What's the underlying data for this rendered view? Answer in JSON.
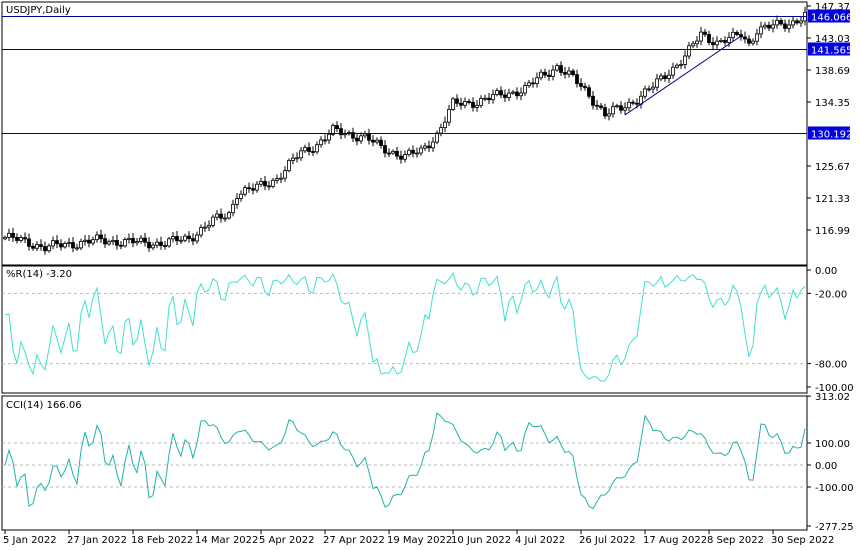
{
  "chart_data": [
    {
      "type": "candlestick",
      "title": "USDJPY,Daily",
      "symbol": "USDJPY",
      "timeframe": "Daily",
      "yticks": [
        147.37,
        143.03,
        138.69,
        134.35,
        125.67,
        121.33,
        116.99
      ],
      "ylim": [
        113.5,
        147.9
      ],
      "hlines": [
        {
          "label": "146.066",
          "value": 146.066
        },
        {
          "label": "141.565",
          "value": 141.565
        },
        {
          "label": "130.192",
          "value": 130.192
        }
      ],
      "trendline": {
        "from": [
          155,
          132.6
        ],
        "to": [
          184,
          143.3
        ]
      },
      "close_waypoints": [
        [
          0,
          116.0
        ],
        [
          6,
          115.3
        ],
        [
          10,
          114.6
        ],
        [
          16,
          115.1
        ],
        [
          24,
          115.6
        ],
        [
          32,
          115.3
        ],
        [
          40,
          115.2
        ],
        [
          46,
          115.9
        ],
        [
          52,
          118.2
        ],
        [
          56,
          119.2
        ],
        [
          58,
          122.0
        ],
        [
          62,
          122.5
        ],
        [
          68,
          124.0
        ],
        [
          74,
          127.5
        ],
        [
          78,
          128.6
        ],
        [
          82,
          130.4
        ],
        [
          86,
          130.0
        ],
        [
          90,
          129.6
        ],
        [
          94,
          128.1
        ],
        [
          100,
          127.0
        ],
        [
          104,
          127.6
        ],
        [
          108,
          130.0
        ],
        [
          112,
          134.0
        ],
        [
          118,
          134.4
        ],
        [
          124,
          135.3
        ],
        [
          130,
          136.1
        ],
        [
          134,
          137.8
        ],
        [
          138,
          139.2
        ],
        [
          142,
          137.5
        ],
        [
          146,
          135.4
        ],
        [
          150,
          132.6
        ],
        [
          154,
          133.5
        ],
        [
          158,
          134.8
        ],
        [
          162,
          136.4
        ],
        [
          166,
          138.5
        ],
        [
          170,
          140.5
        ],
        [
          174,
          143.5
        ],
        [
          178,
          142.5
        ],
        [
          182,
          143.0
        ],
        [
          184,
          143.5
        ],
        [
          186,
          142.2
        ],
        [
          188,
          144.2
        ],
        [
          192,
          144.6
        ],
        [
          196,
          145.0
        ],
        [
          200,
          146.1
        ]
      ]
    },
    {
      "type": "line",
      "title": "%R(14) -3.20",
      "yticks": [
        "0.00",
        "-20.00",
        "-80.00",
        "-100.00"
      ],
      "ylim": [
        -100,
        0
      ],
      "levels": [
        -20,
        -80
      ]
    },
    {
      "type": "line",
      "title": "CCI(14) 166.06",
      "yticks": [
        "313.02",
        "100.00",
        "0.00",
        "-100.00",
        "-277.25"
      ],
      "ylim": [
        -277.25,
        313.02
      ],
      "levels": [
        100,
        0,
        -100
      ]
    }
  ],
  "xticks": [
    "5 Jan 2022",
    "27 Jan 2022",
    "18 Feb 2022",
    "14 Mar 2022",
    "5 Apr 2022",
    "27 Apr 2022",
    "19 May 2022",
    "10 Jun 2022",
    "4 Jul 2022",
    "26 Jul 2022",
    "17 Aug 2022",
    "8 Sep 2022",
    "30 Sep 2022"
  ],
  "colors": {
    "line": "#00008b",
    "label_bg": "#0000e0",
    "wpr": "#40e0d0",
    "cci": "#20b2aa"
  }
}
